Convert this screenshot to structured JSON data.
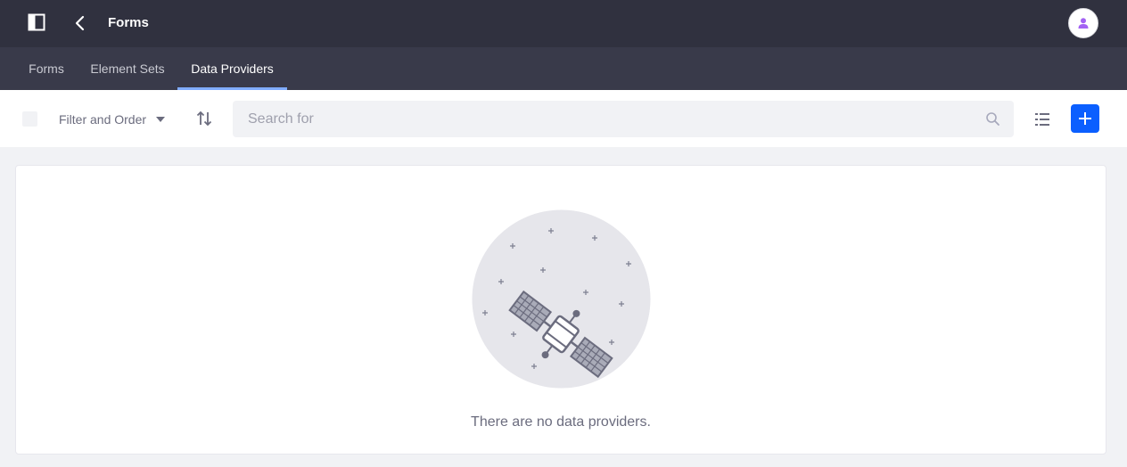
{
  "header": {
    "title": "Forms",
    "icons": {
      "panel": "product-menu-icon",
      "back": "angle-left-icon",
      "avatar": "user-avatar-icon"
    },
    "avatar_color": "#a362f3"
  },
  "navigation": {
    "tabs": [
      {
        "label": "Forms",
        "active": false
      },
      {
        "label": "Element Sets",
        "active": false
      },
      {
        "label": "Data Providers",
        "active": true
      }
    ],
    "active_indicator_color": "#80acff"
  },
  "toolbar": {
    "filter_label": "Filter and Order",
    "search_placeholder": "Search for",
    "search_value": "",
    "icons": {
      "sort": "order-arrows-icon",
      "search": "search-icon",
      "display": "list-view-icon",
      "add": "plus-icon"
    },
    "add_button_color": "#0b5fff"
  },
  "empty_state": {
    "message": "There are no data providers.",
    "illustration": "satellite-illustration"
  }
}
